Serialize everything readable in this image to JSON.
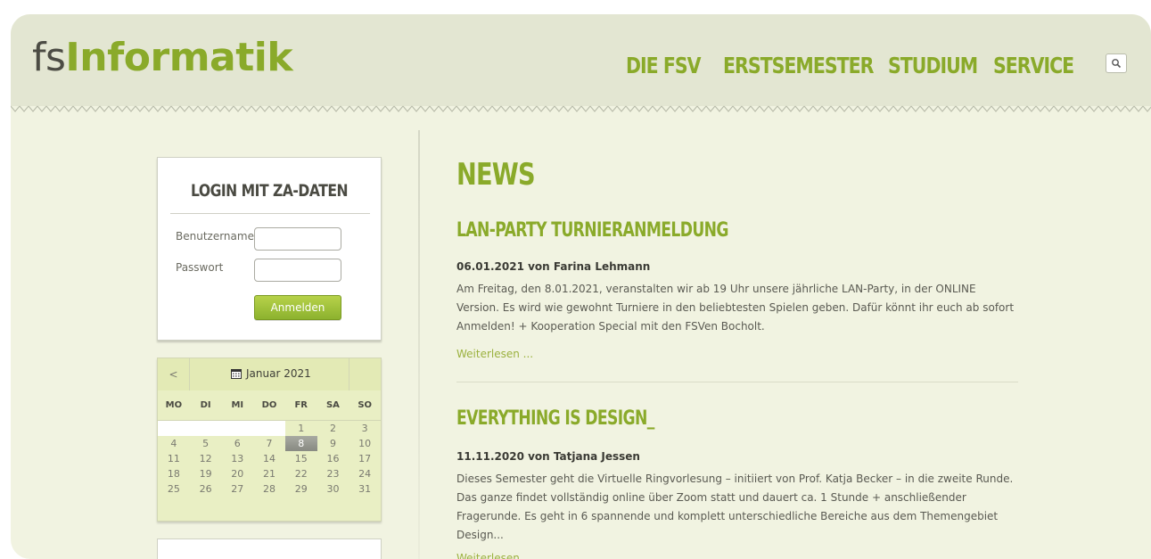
{
  "logo": {
    "prefix": "fs",
    "main": "Informatik"
  },
  "nav": {
    "items": [
      "DIE FSV",
      "ERSTSEMESTER",
      "STUDIUM",
      "SERVICE"
    ],
    "search_icon": "search-icon"
  },
  "login": {
    "title": "LOGIN MIT ZA-DATEN",
    "username_label": "Benutzername",
    "password_label": "Passwort",
    "username_value": "",
    "password_value": "",
    "submit_label": "Anmelden"
  },
  "calendar": {
    "prev_label": "<",
    "month_label": "Januar 2021",
    "weekdays": [
      "MO",
      "DI",
      "MI",
      "DO",
      "FR",
      "SA",
      "SO"
    ],
    "weeks": [
      [
        "",
        "",
        "",
        "",
        "1",
        "2",
        "3"
      ],
      [
        "4",
        "5",
        "6",
        "7",
        "8",
        "9",
        "10"
      ],
      [
        "11",
        "12",
        "13",
        "14",
        "15",
        "16",
        "17"
      ],
      [
        "18",
        "19",
        "20",
        "21",
        "22",
        "23",
        "24"
      ],
      [
        "25",
        "26",
        "27",
        "28",
        "29",
        "30",
        "31"
      ]
    ],
    "today": "8"
  },
  "main": {
    "heading": "NEWS",
    "posts": [
      {
        "title": "LAN-PARTY TURNIERANMELDUNG",
        "meta": "06.01.2021 von Farina Lehmann",
        "body": "Am Freitag, den 8.01.2021, veranstalten wir ab 19 Uhr unsere jährliche LAN-Party, in der ONLINE Version. Es wird wie gewohnt Turniere in den beliebtesten Spielen geben. Dafür könnt ihr euch ab sofort Anmelden! + Kooperation Special mit den FSVen Bocholt.",
        "more": "Weiterlesen ..."
      },
      {
        "title": "EVERYTHING IS DESIGN_",
        "meta": "11.11.2020 von Tatjana Jessen",
        "body": "Dieses Semester geht die Virtuelle Ringvorlesung – initiiert von Prof. Katja Becker – in die zweite Runde. Das ganze findet vollständig online über Zoom statt und dauert ca. 1 Stunde + anschließender Fragerunde. Es geht in 6 spannende und komplett unterschiedliche Bereiche aus dem Themengebiet Design...",
        "more": "Weiterlesen ..."
      }
    ]
  },
  "colors": {
    "accent": "#8aaa2a",
    "background": "#f1f3e1",
    "header": "#e3e6d2"
  }
}
